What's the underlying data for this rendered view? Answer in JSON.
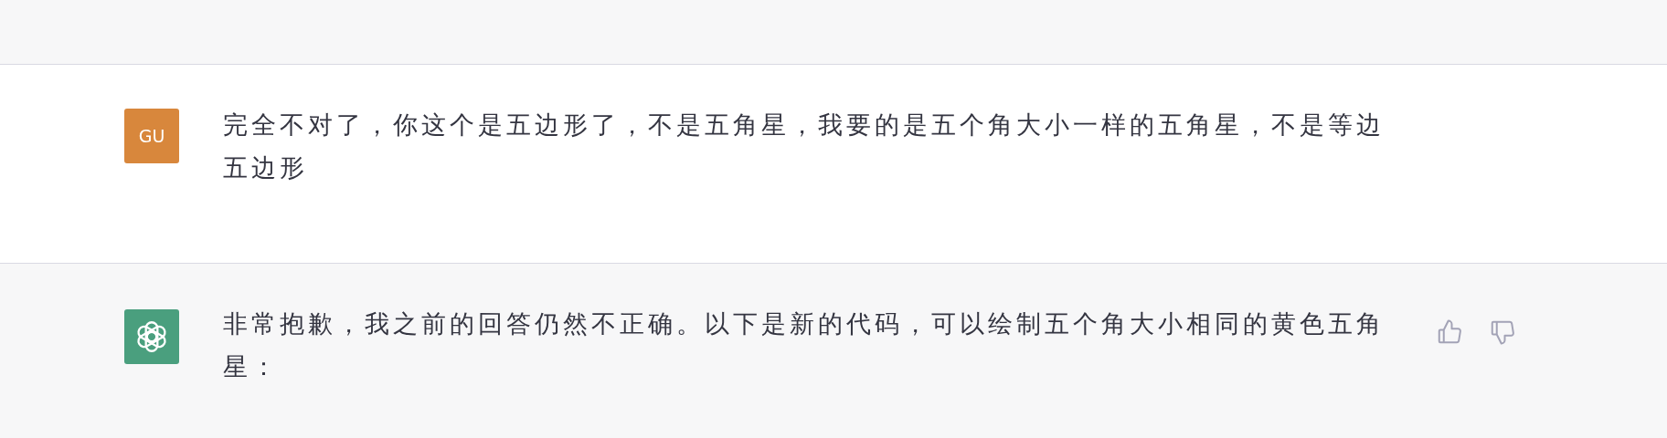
{
  "messages": [
    {
      "kind": "user",
      "avatar": "GU",
      "text": "完全不对了，你这个是五边形了，不是五角星，我要的是五个角大小一样的五角星，不是等边五边形"
    },
    {
      "kind": "assistant",
      "text": "非常抱歉，我之前的回答仍然不正确。以下是新的代码，可以绘制五个角大小相同的黄色五角星："
    }
  ]
}
